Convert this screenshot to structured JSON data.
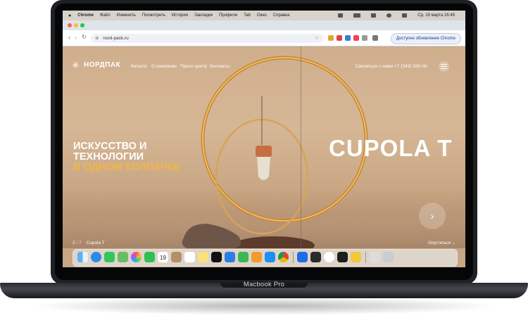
{
  "laptop": {
    "model_label": "Macbook Pro"
  },
  "menubar": {
    "apple_icon": "apple-icon",
    "items": [
      "Chrome",
      "Файл",
      "Изменить",
      "Посмотреть",
      "История",
      "Закладки",
      "Профили",
      "Tab",
      "Окно",
      "Справка"
    ],
    "clock": "Ср, 19 марта  16:49"
  },
  "browser": {
    "url": "nord-pack.ru",
    "update_button": "Доступно обновление Chrome"
  },
  "site": {
    "logo": "НОРДПАК",
    "nav": [
      "Каталог",
      "О компании",
      "Пресс-центр",
      "Контакты"
    ],
    "contact_link": "Связаться с нами",
    "phone": "+7 (343) 339-00-",
    "headline_white": "ИСКУССТВО И ТЕХНОЛОГИИ",
    "headline_gold": "В ОДНОМ КОЛПАЧКЕ",
    "product_name": "CUPOLA T",
    "pager_current": "2",
    "pager_sep": "/",
    "pager_total": "7",
    "pager_label": "Cupola T",
    "scroll_hint": "Опуститься ⌄",
    "next_icon": "chevron-right-icon"
  },
  "dock": {
    "icons": [
      "finder-icon",
      "safari-icon",
      "messages-icon",
      "maps-icon",
      "photos-icon",
      "facetime-icon",
      "calendar-icon",
      "contacts-icon",
      "reminders-icon",
      "notes-icon",
      "apple-tv-icon",
      "keynote-icon",
      "numbers-icon",
      "pages-icon",
      "app-store-icon",
      "chrome-icon",
      "xcode-icon",
      "app-icon",
      "yandex-browser-icon",
      "figma-icon",
      "app-icon-2",
      "preview-icon",
      "trash-icon"
    ],
    "calendar_day": "19"
  }
}
